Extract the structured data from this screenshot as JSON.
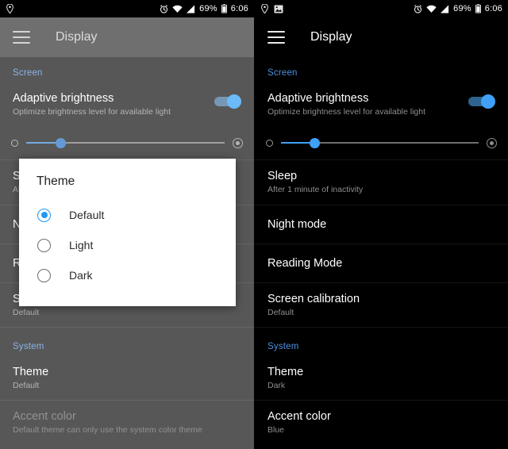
{
  "status_bar": {
    "left_icons": [
      "location-icon",
      "image-icon"
    ],
    "right_icons": [
      "alarm-icon",
      "wifi-icon",
      "signal-icon",
      "battery-icon"
    ],
    "battery_percent": "69%",
    "time": "6:06"
  },
  "toolbar": {
    "menu_icon": "hamburger-menu-icon",
    "title": "Display"
  },
  "sections": {
    "screen_label": "Screen",
    "system_label": "System"
  },
  "left_panel": {
    "adaptive": {
      "title": "Adaptive brightness",
      "subtitle": "Optimize brightness level for available light",
      "toggle_on": true
    },
    "slider": {
      "value_percent": 17,
      "left_icon": "brightness-low-icon",
      "right_icon": "brightness-high-icon"
    },
    "rows": [
      {
        "title": "Sleep",
        "subtitle": "After 1 minute of inactivity"
      },
      {
        "title": "Night mode",
        "subtitle": ""
      },
      {
        "title": "Reading Mode",
        "subtitle": ""
      },
      {
        "title": "Screen calibration",
        "subtitle": "Default"
      }
    ],
    "system_rows": [
      {
        "title": "Theme",
        "subtitle": "Default",
        "disabled": false
      },
      {
        "title": "Accent color",
        "subtitle": "Default theme can only use the system color theme",
        "disabled": true
      }
    ]
  },
  "right_panel": {
    "adaptive": {
      "title": "Adaptive brightness",
      "subtitle": "Optimize brightness level for available light",
      "toggle_on": true
    },
    "slider": {
      "value_percent": 17,
      "left_icon": "brightness-low-icon",
      "right_icon": "brightness-high-icon"
    },
    "rows": [
      {
        "title": "Sleep",
        "subtitle": "After 1 minute of inactivity"
      },
      {
        "title": "Night mode",
        "subtitle": ""
      },
      {
        "title": "Reading Mode",
        "subtitle": ""
      },
      {
        "title": "Screen calibration",
        "subtitle": "Default"
      }
    ],
    "system_rows": [
      {
        "title": "Theme",
        "subtitle": "Dark",
        "disabled": false
      },
      {
        "title": "Accent color",
        "subtitle": "Blue",
        "disabled": false
      }
    ]
  },
  "dialog": {
    "title": "Theme",
    "options": [
      {
        "label": "Default",
        "selected": true
      },
      {
        "label": "Light",
        "selected": false
      },
      {
        "label": "Dark",
        "selected": false
      }
    ]
  },
  "colors": {
    "accent_blue": "#2196f3",
    "section_header_blue": "#4d8fe0",
    "background_dark": "#000000",
    "scrim_gray": "#616161"
  }
}
